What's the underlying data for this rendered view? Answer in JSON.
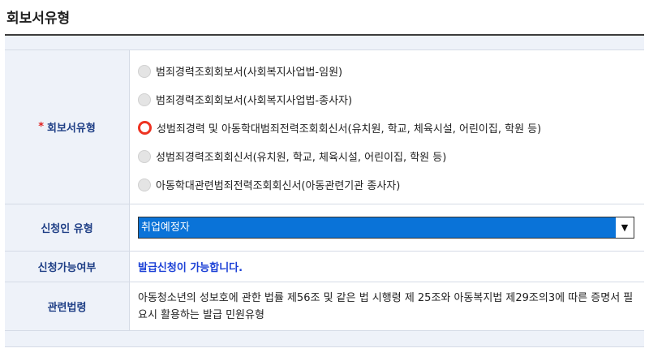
{
  "page": {
    "title": "회보서유형"
  },
  "report_type": {
    "label": "회보서유형",
    "required_mark": "*",
    "options": [
      {
        "label": "범죄경력조회회보서(사회복지사업법-임원)",
        "checked": false
      },
      {
        "label": "범죄경력조회회보서(사회복지사업법-종사자)",
        "checked": false
      },
      {
        "label": "성범죄경력 및 아동학대범죄전력조회회신서(유치원, 학교, 체육시설, 어린이집, 학원 등)",
        "checked": true
      },
      {
        "label": "성범죄경력조회회신서(유치원, 학교, 체육시설, 어린이집, 학원 등)",
        "checked": false
      },
      {
        "label": "아동학대관련범죄전력조회회신서(아동관련기관 종사자)",
        "checked": false
      }
    ]
  },
  "applicant_type": {
    "label": "신청인 유형",
    "selected": "취업예정자",
    "arrow_icon": "▼"
  },
  "availability": {
    "label": "신청가능여부",
    "value": "발급신청이 가능합니다."
  },
  "related_law": {
    "label": "관련법령",
    "text": "아동청소년의 성보호에 관한 법률 제56조 및 같은 법 시행령 제 25조와 아동복지법 제29조의3에 따른 증명서 필요시 활용하는 발급 민원유형"
  },
  "colors": {
    "label_text": "#1f3f86",
    "label_bg": "#eef2f9",
    "required": "#e02020",
    "select_highlight": "#0a73d8",
    "radio_checked": "#ee3322",
    "availability_text": "#1a3fd6"
  }
}
